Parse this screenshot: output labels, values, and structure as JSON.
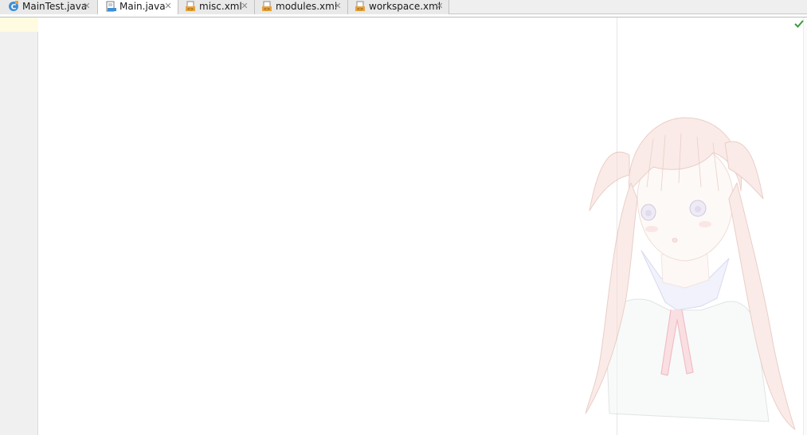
{
  "tabs": [
    {
      "label": "MainTest.java",
      "icon": "java-class-icon",
      "active": false
    },
    {
      "label": "Main.java",
      "icon": "java-file-icon",
      "active": true
    },
    {
      "label": "misc.xml",
      "icon": "xml-file-icon",
      "active": false
    },
    {
      "label": "modules.xml",
      "icon": "xml-file-icon",
      "active": false
    },
    {
      "label": "workspace.xml",
      "icon": "xml-file-icon",
      "active": false
    }
  ],
  "tab_close_glyph": "✕",
  "status": {
    "inspection_icon": "checkmark-icon",
    "inspection_color": "#3c9a3c"
  },
  "colors": {
    "caret_line": "#fffbe0",
    "gutter": "#f0f0f0",
    "java_icon": "#3d8fd6",
    "xml_icon": "#e8a33a"
  },
  "background_image": {
    "icon": "anime-girl-illustration"
  }
}
